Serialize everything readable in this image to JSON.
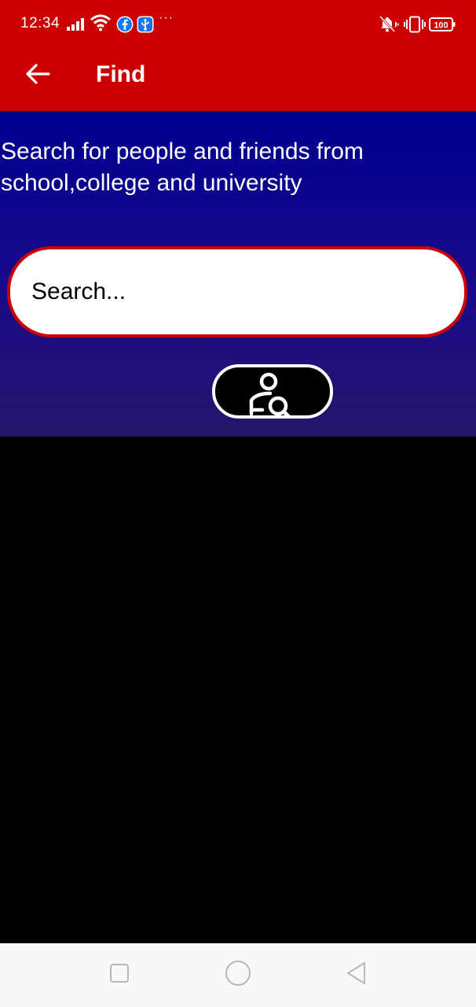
{
  "status_bar": {
    "time": "12:34",
    "more_notifications": "···",
    "battery_level": "100",
    "icons": [
      "signal-icon",
      "wifi-icon",
      "facebook-icon",
      "usb-icon",
      "mute-icon",
      "vibrate-icon",
      "battery-icon"
    ]
  },
  "app_bar": {
    "title": "Find",
    "back_icon": "arrow-left-icon"
  },
  "main": {
    "description": "Search for people and friends from school,college and university",
    "search": {
      "placeholder": "Search...",
      "value": ""
    },
    "find_button_icon": "person-search-icon"
  },
  "nav_bar": {
    "items": [
      "recents-square-icon",
      "home-circle-icon",
      "back-triangle-icon"
    ]
  },
  "colors": {
    "app_bar": "#cc0000",
    "content_gradient_top": "#00008f",
    "content_gradient_bottom": "#26166a",
    "search_border": "#cc0000",
    "background": "#000000",
    "nav_bar": "#f8f8f8"
  }
}
